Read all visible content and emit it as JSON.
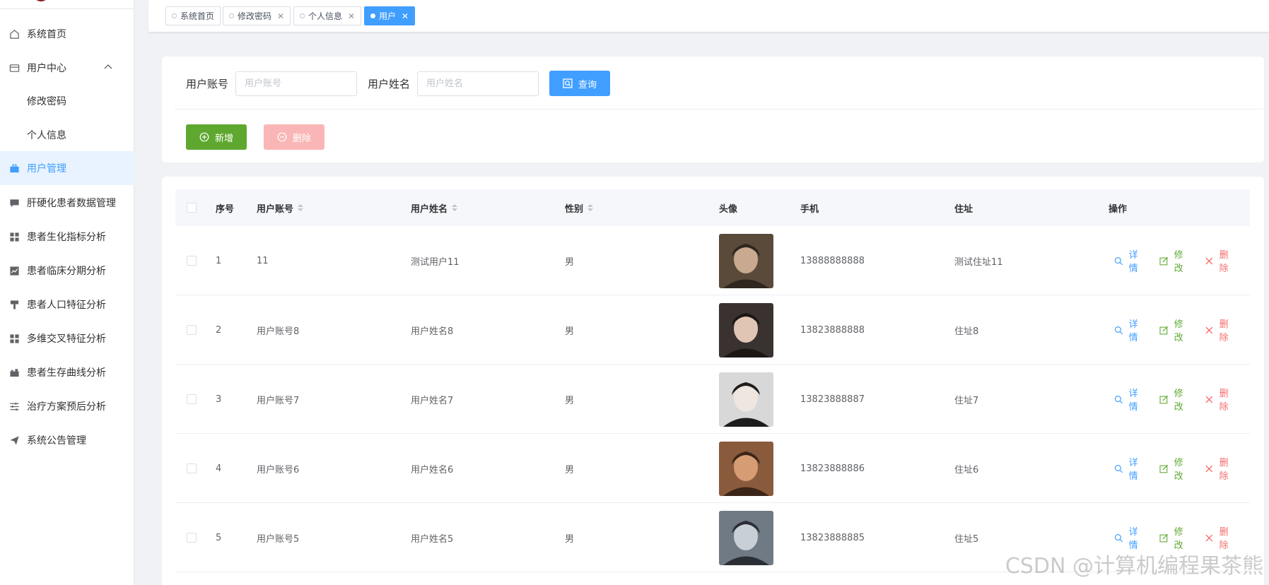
{
  "sidebar": {
    "items": [
      {
        "label": "系统首页",
        "icon": "home-icon"
      },
      {
        "label": "用户中心",
        "icon": "wallet-icon"
      },
      {
        "label": "修改密码"
      },
      {
        "label": "个人信息"
      },
      {
        "label": "用户管理",
        "icon": "briefcase-icon"
      },
      {
        "label": "肝硬化患者数据管理",
        "icon": "chat-icon"
      },
      {
        "label": "患者生化指标分析",
        "icon": "grid-icon"
      },
      {
        "label": "患者临床分期分析",
        "icon": "line-chart-icon"
      },
      {
        "label": "患者人口特征分析",
        "icon": "brush-icon"
      },
      {
        "label": "多维交叉特征分析",
        "icon": "grid-icon"
      },
      {
        "label": "患者生存曲线分析",
        "icon": "camera-icon"
      },
      {
        "label": "治疗方案预后分析",
        "icon": "sliders-icon"
      },
      {
        "label": "系统公告管理",
        "icon": "send-icon"
      }
    ]
  },
  "tags": [
    {
      "label": "系统首页"
    },
    {
      "label": "修改密码"
    },
    {
      "label": "个人信息"
    },
    {
      "label": "用户"
    }
  ],
  "search": {
    "account_label": "用户账号",
    "account_placeholder": "用户账号",
    "name_label": "用户姓名",
    "name_placeholder": "用户姓名",
    "query_label": "查询",
    "add_label": "新增",
    "delete_label": "删除"
  },
  "table": {
    "headers": [
      "序号",
      "用户账号",
      "用户姓名",
      "性别",
      "头像",
      "手机",
      "住址",
      "操作"
    ],
    "rows": [
      {
        "index": "1",
        "account": "11",
        "name": "测试用户11",
        "gender": "男",
        "phone": "13888888888",
        "address": "测试住址11"
      },
      {
        "index": "2",
        "account": "用户账号8",
        "name": "用户姓名8",
        "gender": "男",
        "phone": "13823888888",
        "address": "住址8"
      },
      {
        "index": "3",
        "account": "用户账号7",
        "name": "用户姓名7",
        "gender": "男",
        "phone": "13823888887",
        "address": "住址7"
      },
      {
        "index": "4",
        "account": "用户账号6",
        "name": "用户姓名6",
        "gender": "男",
        "phone": "13823888886",
        "address": "住址6"
      },
      {
        "index": "5",
        "account": "用户账号5",
        "name": "用户姓名5",
        "gender": "男",
        "phone": "13823888885",
        "address": "住址5"
      }
    ],
    "actions": {
      "detail": "详情",
      "edit": "修改",
      "remove": "删除"
    }
  },
  "watermark": "CSDN @计算机编程果茶熊"
}
